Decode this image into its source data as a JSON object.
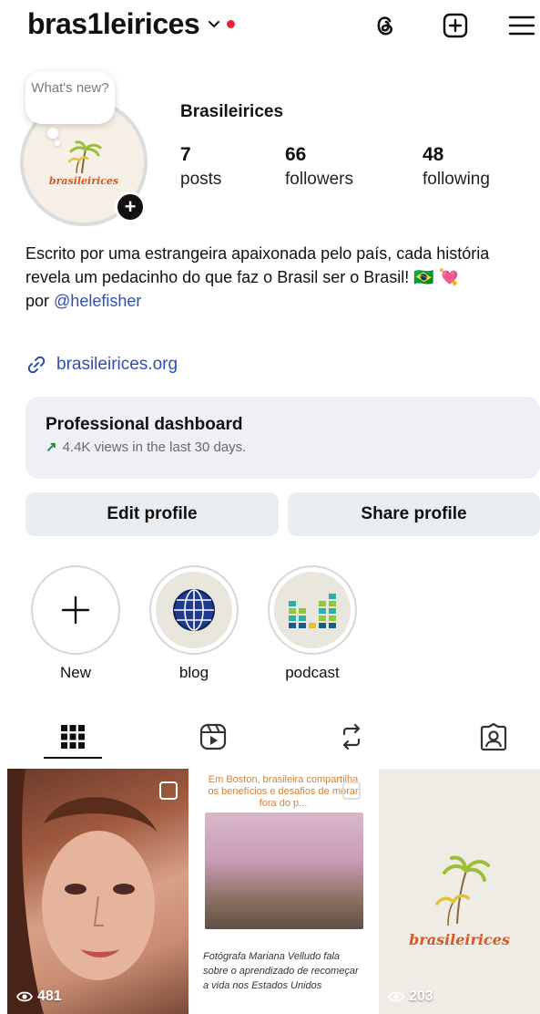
{
  "header": {
    "username": "bras1leirices",
    "icons": [
      "threads-icon",
      "create-icon",
      "menu-icon"
    ]
  },
  "profile": {
    "note": "What's new?",
    "display_name": "Brasileirices",
    "avatar_text": "brasileirices",
    "stats": [
      {
        "value": "7",
        "label": "posts"
      },
      {
        "value": "66",
        "label": "followers"
      },
      {
        "value": "48",
        "label": "following"
      }
    ]
  },
  "bio": {
    "line1": "Escrito por uma estrangeira apaixonada pelo país, cada história revela um pedacinho do que faz o Brasil ser o Brasil! 🇧🇷 💘",
    "por": "por ",
    "mention": "@helefisher",
    "link": "brasileirices.org"
  },
  "dashboard": {
    "title": "Professional dashboard",
    "subtitle": "4.4K views in the last 30 days."
  },
  "buttons": {
    "edit": "Edit profile",
    "share": "Share profile"
  },
  "highlights": [
    {
      "label": "New"
    },
    {
      "label": "blog"
    },
    {
      "label": "podcast"
    }
  ],
  "tabs": [
    "grid-icon",
    "reels-icon",
    "reposts-icon",
    "tagged-icon"
  ],
  "posts": [
    {
      "views": "481"
    },
    {
      "header": "Em Boston, brasileira compartilha os benefícios e desafios de morar fora do p...",
      "caption": "Fotógrafa Mariana Velludo fala sobre o aprendizado de recomeçar a vida nos Estados Unidos"
    },
    {
      "views": "203",
      "brand": "brasileirices"
    }
  ],
  "colors": {
    "accent_link": "#2f4fb1",
    "notification_dot": "#e8263a",
    "button_bg": "#eaedf0",
    "dashboard_bg": "#eef0f3",
    "trend_green": "#1c8a3b",
    "brand_orange": "#d25a2a"
  }
}
